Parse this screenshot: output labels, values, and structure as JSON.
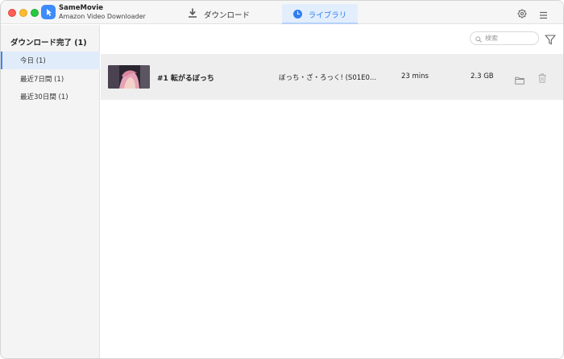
{
  "app": {
    "name": "SameMovie",
    "subtitle": "Amazon Video Downloader"
  },
  "tabs": [
    {
      "label": "ダウンロード",
      "icon": "download-icon",
      "active": false
    },
    {
      "label": "ライブラリ",
      "icon": "clock-icon",
      "active": true
    }
  ],
  "sidebar": {
    "heading": "ダウンロード完了 (1)",
    "items": [
      {
        "label": "今日 (1)",
        "active": true
      },
      {
        "label": "最近7日間 (1)",
        "active": false
      },
      {
        "label": "最近30日間 (1)",
        "active": false
      }
    ]
  },
  "search": {
    "placeholder": "検索",
    "value": ""
  },
  "list": {
    "rows": [
      {
        "title": "#1 転がるぼっち",
        "series": "ぼっち・ざ・ろっく! (S01E0...",
        "duration": "23 mins",
        "size": "2.3 GB"
      }
    ]
  },
  "colors": {
    "accent": "#2f7ff0",
    "active_bg": "#e1ecfb",
    "row_bg": "#eeeeee",
    "sidebar_bg": "#f4f4f4"
  }
}
